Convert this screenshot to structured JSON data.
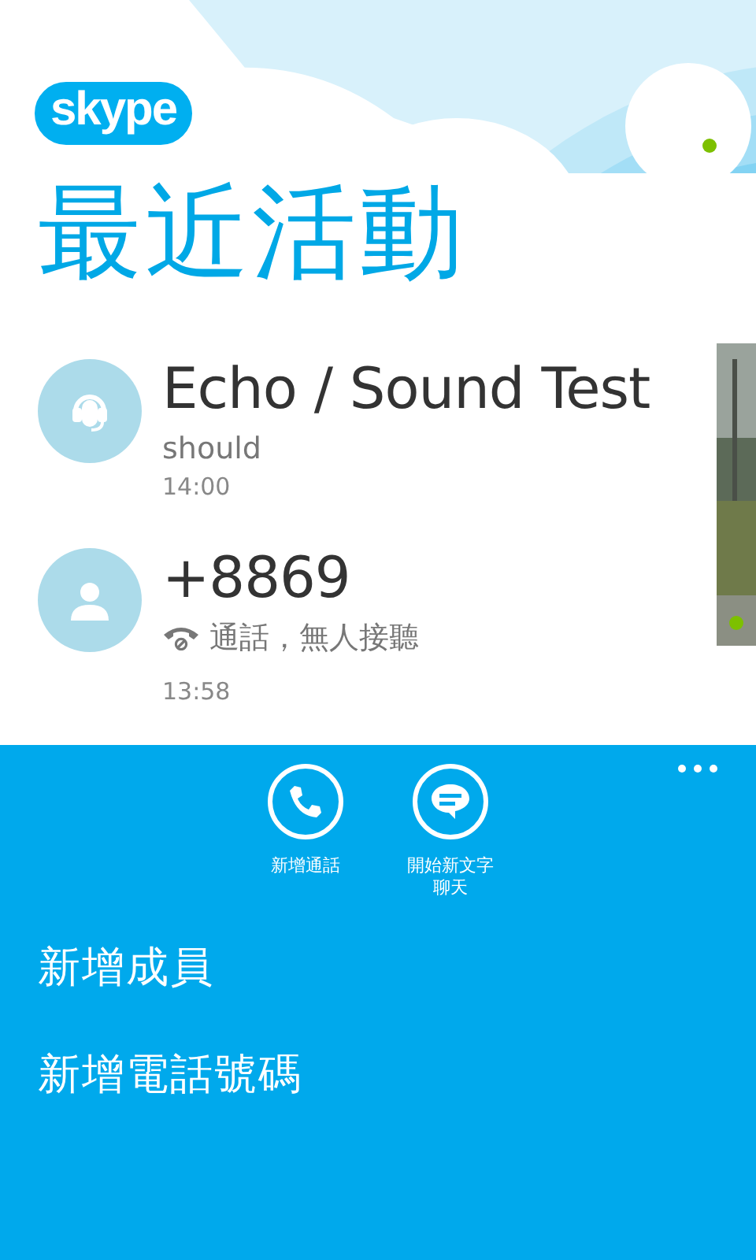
{
  "logo": "skype",
  "title": "最近活動",
  "recent": [
    {
      "kind": "echo",
      "name": "Echo / Sound Test",
      "message": "should",
      "time": "14:00"
    },
    {
      "kind": "missed_call",
      "name": "+8869",
      "message": "通話，無人接聽",
      "time": "13:58"
    }
  ],
  "app_bar": {
    "buttons": [
      {
        "kind": "call",
        "label": "新增通話"
      },
      {
        "kind": "chat",
        "label": "開始新文字聊天"
      }
    ],
    "menu_items": [
      "新增成員",
      "新增電話號碼"
    ]
  }
}
